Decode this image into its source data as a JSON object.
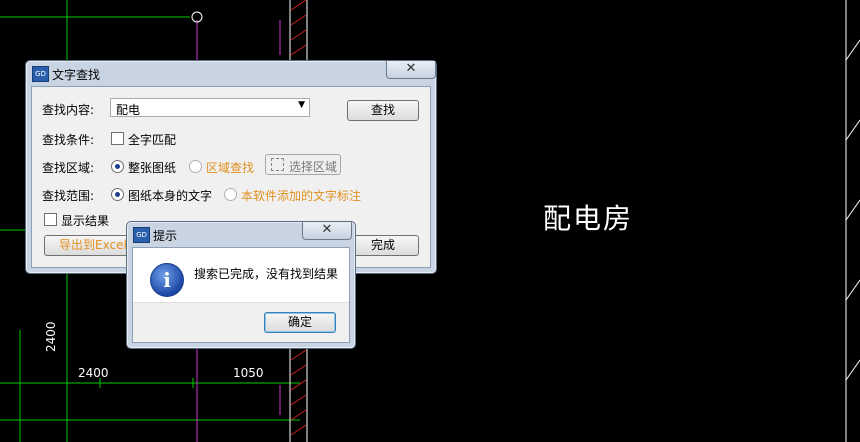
{
  "cad": {
    "room_label": "配电房",
    "dim_left": "2400",
    "dim_right": "1050",
    "dim_vertical": "2400"
  },
  "find_dialog": {
    "title": "文字查找",
    "close_glyph": "✕",
    "content_label": "查找内容:",
    "content_value": "配电",
    "find_button": "查找",
    "condition_label": "查找条件:",
    "whole_word": "全字匹配",
    "area_label": "查找区域:",
    "area_whole": "整张图纸",
    "area_region": "区域查找",
    "select_area_button": "选择区域",
    "scope_label": "查找范围:",
    "scope_self": "图纸本身的文字",
    "scope_added": "本软件添加的文字标注",
    "show_results": "显示结果",
    "export_button": "导出到Excel",
    "done_button": "完成"
  },
  "message_box": {
    "title": "提示",
    "close_glyph": "✕",
    "message": "搜索已完成，没有找到结果",
    "icon": "i",
    "ok_button": "确定"
  },
  "colors": {
    "accent_orange": "#e09020",
    "cad_green": "#00c800",
    "cad_magenta": "#cc33cc"
  }
}
